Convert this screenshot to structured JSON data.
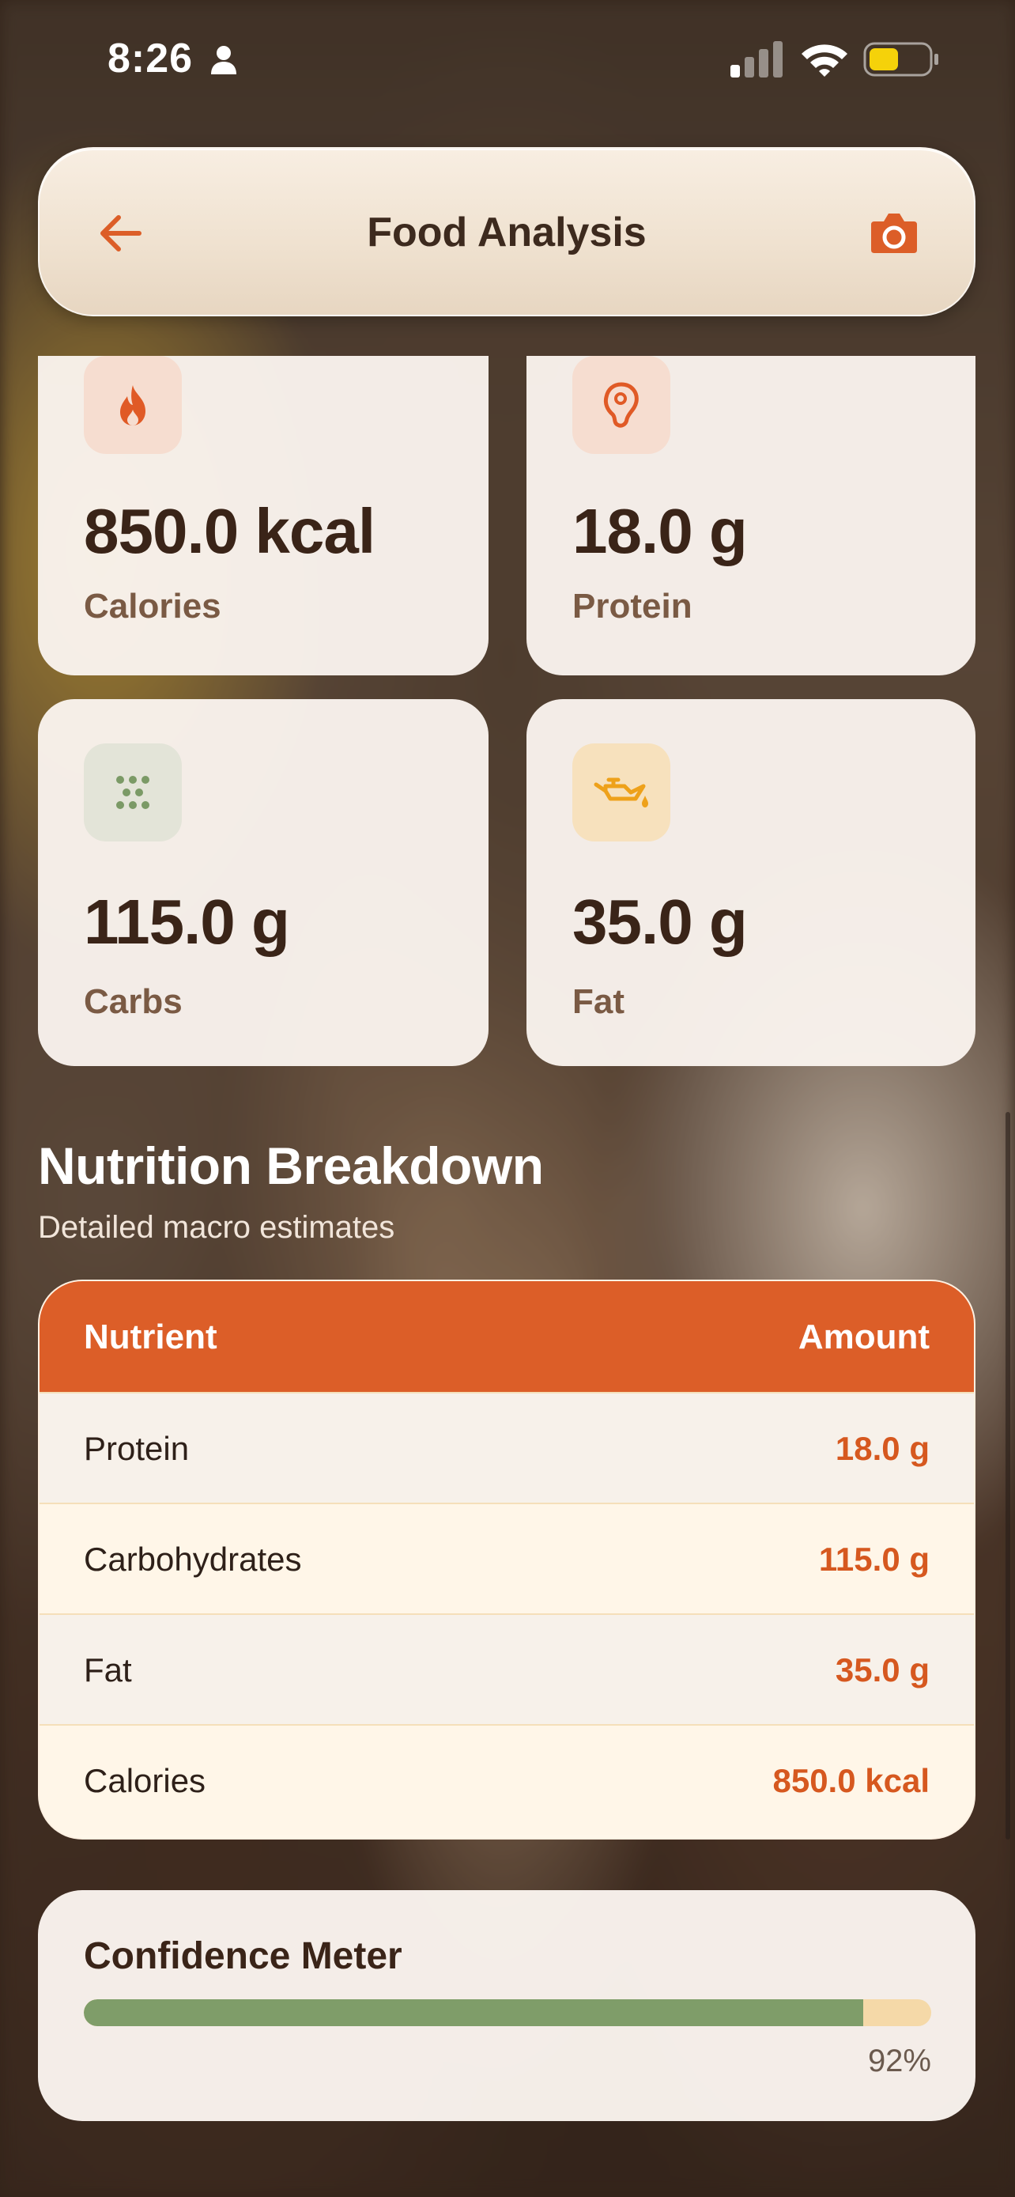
{
  "status_bar": {
    "time": "8:26",
    "icons": [
      "person-icon",
      "signal-icon",
      "wifi-icon",
      "battery-icon"
    ],
    "battery_color": "#f5d20a"
  },
  "header": {
    "title": "Food Analysis",
    "back_icon": "arrow-left-icon",
    "camera_icon": "camera-icon"
  },
  "macros": [
    {
      "value": "850.0 kcal",
      "label": "Calories",
      "icon": "flame-icon",
      "icon_color": "#e05a26",
      "icon_bg": "#f6ddd0"
    },
    {
      "value": "18.0 g",
      "label": "Protein",
      "icon": "meat-icon",
      "icon_color": "#e05a26",
      "icon_bg": "#f6ddd0"
    },
    {
      "value": "115.0 g",
      "label": "Carbs",
      "icon": "grain-icon",
      "icon_color": "#7b9a66",
      "icon_bg": "#e3e4d8"
    },
    {
      "value": "35.0 g",
      "label": "Fat",
      "icon": "oil-icon",
      "icon_color": "#eea11a",
      "icon_bg": "#f7e1bd"
    }
  ],
  "breakdown": {
    "title": "Nutrition Breakdown",
    "subtitle": "Detailed macro estimates",
    "headers": {
      "nutrient": "Nutrient",
      "amount": "Amount"
    },
    "rows": [
      {
        "nutrient": "Protein",
        "amount": "18.0 g"
      },
      {
        "nutrient": "Carbohydrates",
        "amount": "115.0 g"
      },
      {
        "nutrient": "Fat",
        "amount": "35.0 g"
      },
      {
        "nutrient": "Calories",
        "amount": "850.0 kcal"
      }
    ]
  },
  "confidence": {
    "title": "Confidence Meter",
    "percent_label": "92%",
    "value": 0.92
  },
  "colors": {
    "accent": "#dc5e28",
    "dark_text": "#3a2418",
    "meter_fill": "#7f9d69",
    "meter_track": "#f5d9a8"
  }
}
